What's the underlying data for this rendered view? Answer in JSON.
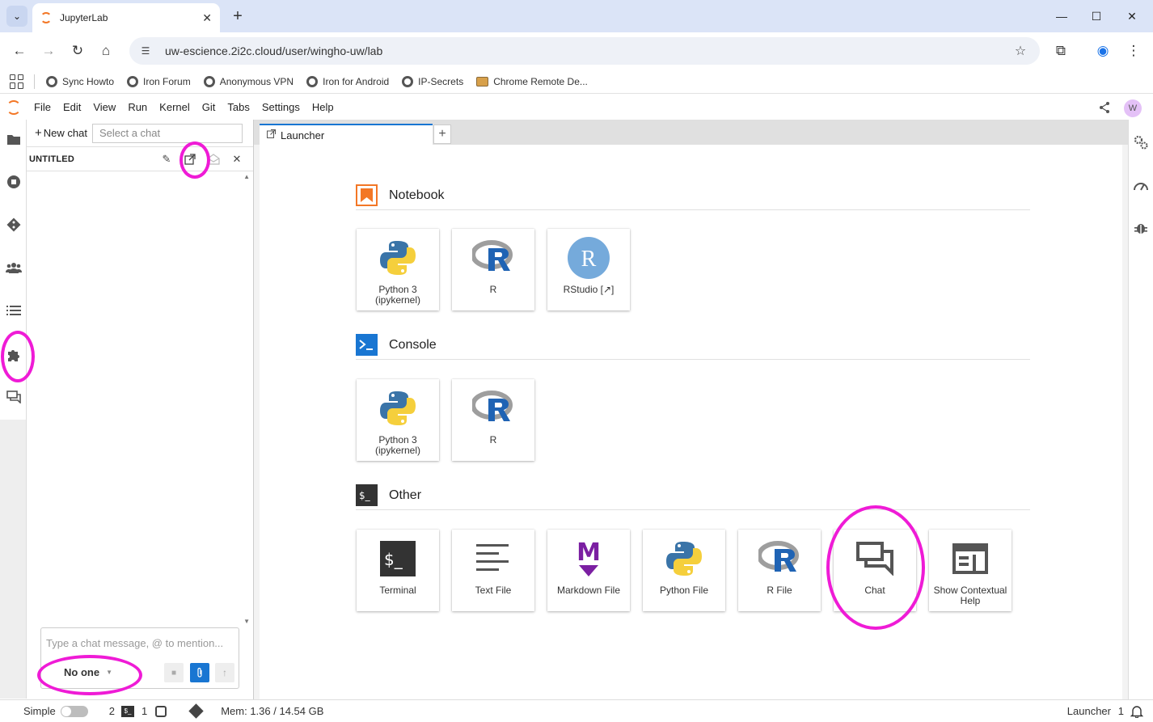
{
  "browser": {
    "tab_title": "JupyterLab",
    "url": "uw-escience.2i2c.cloud/user/wingho-uw/lab",
    "bookmarks": [
      {
        "label": "Sync Howto",
        "icon": "globe-icon"
      },
      {
        "label": "Iron Forum",
        "icon": "globe-icon"
      },
      {
        "label": "Anonymous VPN",
        "icon": "globe-icon"
      },
      {
        "label": "Iron for Android",
        "icon": "globe-icon"
      },
      {
        "label": "IP-Secrets",
        "icon": "globe-icon"
      },
      {
        "label": "Chrome Remote De...",
        "icon": "remote-desktop-icon"
      }
    ]
  },
  "menu": {
    "items": [
      "File",
      "Edit",
      "View",
      "Run",
      "Kernel",
      "Git",
      "Tabs",
      "Settings",
      "Help"
    ],
    "user_initial": "W"
  },
  "chat_panel": {
    "new_chat_label": "New chat",
    "select_placeholder": "Select a chat",
    "chat_title": "UNTITLED",
    "input_placeholder": "Type a chat message, @ to mention...",
    "recipient": "No one"
  },
  "launcher": {
    "tab_label": "Launcher",
    "sections": {
      "notebook": {
        "title": "Notebook",
        "cards": [
          "Python 3\n(ipykernel)",
          "R",
          "RStudio [↗]"
        ]
      },
      "console": {
        "title": "Console",
        "cards": [
          "Python 3\n(ipykernel)",
          "R"
        ]
      },
      "other": {
        "title": "Other",
        "cards": [
          "Terminal",
          "Text File",
          "Markdown File",
          "Python File",
          "R File",
          "Chat",
          "Show Contextual\nHelp"
        ]
      }
    }
  },
  "statusbar": {
    "mode_label": "Simple",
    "terminals_count": "2",
    "kernels_count": "1",
    "memory": "Mem: 1.36 / 14.54 GB",
    "current_activity": "Launcher",
    "notifications_count": "1"
  },
  "colors": {
    "annotation": "#ef1bd6",
    "jupyter_orange": "#f37726",
    "accent_blue": "#1976d2"
  }
}
